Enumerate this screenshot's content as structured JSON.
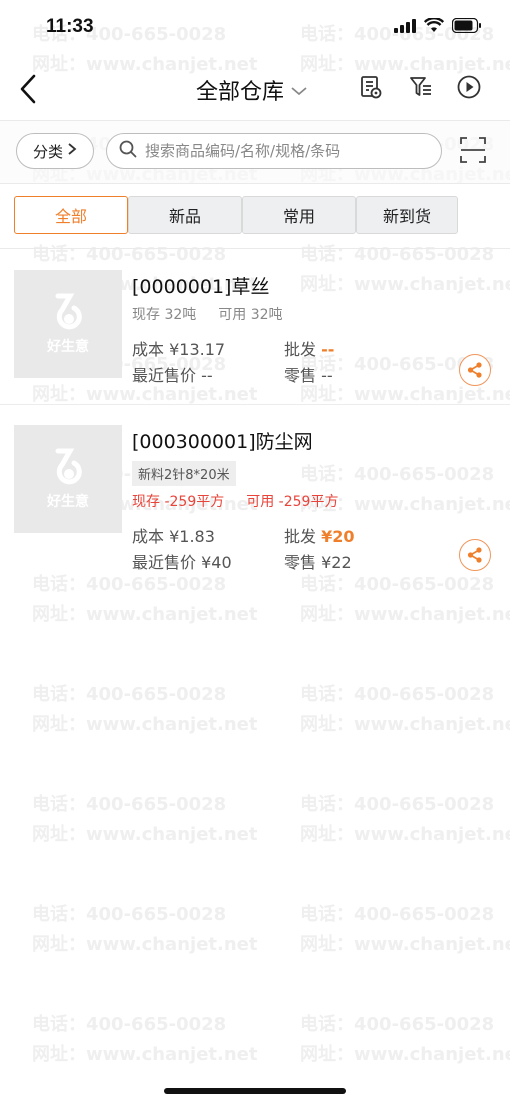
{
  "watermark": {
    "phone": "电话：400-665-0028",
    "site": "网址：www.chanjet.net"
  },
  "status_bar": {
    "time": "11:33"
  },
  "nav": {
    "title": "全部仓库"
  },
  "search": {
    "category_label": "分类",
    "placeholder": "搜索商品编码/名称/规格/条码"
  },
  "filters": [
    {
      "label": "全部",
      "active": true
    },
    {
      "label": "新品",
      "active": false
    },
    {
      "label": "常用",
      "active": false
    },
    {
      "label": "新到货",
      "active": false
    }
  ],
  "products": [
    {
      "image_text": "好生意",
      "name": "[0000001]草丝",
      "stock_now": "现存 32吨",
      "stock_avail": "可用 32吨",
      "cost_label": "成本",
      "cost": "¥13.17",
      "wholesale_label": "批发",
      "wholesale": "--",
      "last_price_label": "最近售价",
      "last_price": "--",
      "retail_label": "零售",
      "retail": "--"
    },
    {
      "image_text": "好生意",
      "name": "[000300001]防尘网",
      "spec": "新料2针8*20米",
      "stock_now": "现存 -259平方",
      "stock_avail": "可用 -259平方",
      "cost_label": "成本",
      "cost": "¥1.83",
      "wholesale_label": "批发",
      "wholesale": "¥20",
      "last_price_label": "最近售价",
      "last_price": "¥40",
      "retail_label": "零售",
      "retail": "¥22"
    }
  ],
  "colors": {
    "accent": "#f07f2c",
    "negative": "#e8443a"
  }
}
